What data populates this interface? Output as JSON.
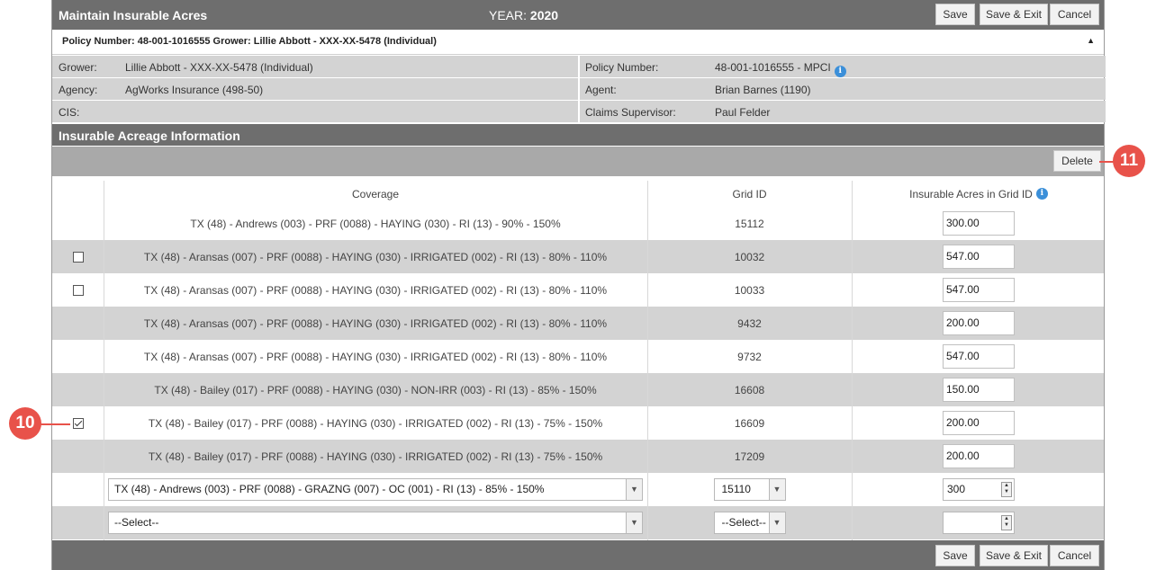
{
  "title": "Maintain Insurable Acres",
  "year_label": "YEAR:",
  "year_value": "2020",
  "buttons": {
    "save": "Save",
    "save_exit": "Save & Exit",
    "cancel": "Cancel",
    "delete": "Delete"
  },
  "policy_bar": "Policy Number: 48-001-1016555 Grower: Lillie Abbott - XXX-XX-5478 (Individual)",
  "info": {
    "grower_label": "Grower:",
    "grower": "Lillie Abbott - XXX-XX-5478 (Individual)",
    "agency_label": "Agency:",
    "agency": "AgWorks Insurance (498-50)",
    "cis_label": "CIS:",
    "cis": "",
    "policy_label": "Policy Number:",
    "policy": "48-001-1016555 - MPCI",
    "agent_label": "Agent:",
    "agent": "Brian Barnes (1190)",
    "claims_label": "Claims Supervisor:",
    "claims": "Paul Felder"
  },
  "section_title": "Insurable Acreage Information",
  "columns": {
    "coverage": "Coverage",
    "grid": "Grid ID",
    "acres": "Insurable Acres in Grid ID"
  },
  "rows": [
    {
      "coverage": "TX (48) - Andrews (003) - PRF (0088) - HAYING (030) - RI (13) - 90% - 150%",
      "grid": "15112",
      "acres": "300.00",
      "checkbox": "none"
    },
    {
      "coverage": "TX (48) - Aransas (007) - PRF (0088) - HAYING (030) - IRRIGATED (002) - RI (13) - 80% - 110%",
      "grid": "10032",
      "acres": "547.00",
      "checkbox": "unchecked"
    },
    {
      "coverage": "TX (48) - Aransas (007) - PRF (0088) - HAYING (030) - IRRIGATED (002) - RI (13) - 80% - 110%",
      "grid": "10033",
      "acres": "547.00",
      "checkbox": "unchecked"
    },
    {
      "coverage": "TX (48) - Aransas (007) - PRF (0088) - HAYING (030) - IRRIGATED (002) - RI (13) - 80% - 110%",
      "grid": "9432",
      "acres": "200.00",
      "checkbox": "none"
    },
    {
      "coverage": "TX (48) - Aransas (007) - PRF (0088) - HAYING (030) - IRRIGATED (002) - RI (13) - 80% - 110%",
      "grid": "9732",
      "acres": "547.00",
      "checkbox": "none"
    },
    {
      "coverage": "TX (48) - Bailey (017) - PRF (0088) - HAYING (030) - NON-IRR (003) - RI (13) - 85% - 150%",
      "grid": "16608",
      "acres": "150.00",
      "checkbox": "none"
    },
    {
      "coverage": "TX (48) - Bailey (017) - PRF (0088) - HAYING (030) - IRRIGATED (002) - RI (13) - 75% - 150%",
      "grid": "16609",
      "acres": "200.00",
      "checkbox": "checked"
    },
    {
      "coverage": "TX (48) - Bailey (017) - PRF (0088) - HAYING (030) - IRRIGATED (002) - RI (13) - 75% - 150%",
      "grid": "17209",
      "acres": "200.00",
      "checkbox": "none"
    }
  ],
  "new_rows": [
    {
      "coverage": "TX (48) - Andrews (003) - PRF (0088) - GRAZNG (007) - OC (001) - RI (13) - 85% - 150%",
      "grid": "15110",
      "acres": "300"
    },
    {
      "coverage": "--Select--",
      "grid": "--Select--",
      "acres": ""
    }
  ],
  "callouts": {
    "a": "11",
    "b": "10"
  }
}
